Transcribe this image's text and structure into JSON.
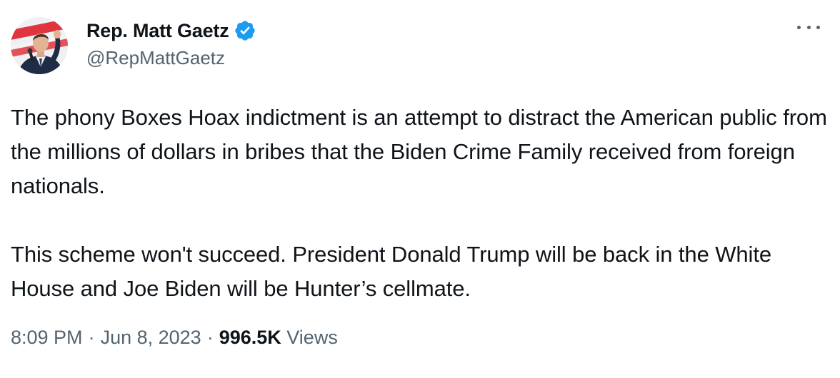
{
  "author": {
    "name": "Rep. Matt Gaetz",
    "handle": "@RepMattGaetz",
    "verified_color": "#1d9bf0"
  },
  "tweet": {
    "paragraphs": [
      "The phony Boxes Hoax indictment is an attempt to distract the American public from the millions of dollars in bribes that the Biden Crime Family received from foreign nationals.",
      "This scheme won't succeed. President Donald Trump will be back in the White House and Joe Biden will be Hunter’s cellmate."
    ]
  },
  "meta": {
    "time": "8:09 PM",
    "separator": "·",
    "date": "Jun 8, 2023",
    "views_count": "996.5K",
    "views_label": "Views"
  },
  "icons": {
    "more": "more-horizontal-icon",
    "verified": "verified-badge-icon"
  }
}
